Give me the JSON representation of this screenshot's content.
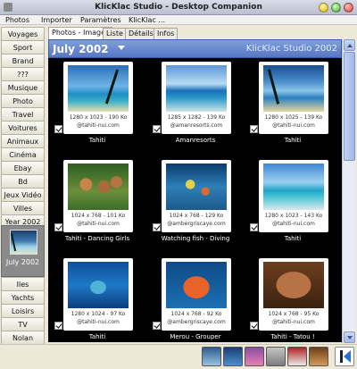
{
  "window": {
    "title": "KlicKlac Studio - Desktop Companion"
  },
  "menu": [
    "Photos",
    "Importer",
    "Paramètres",
    "KlicKlac ..."
  ],
  "sidebar": {
    "items": [
      "Voyages",
      "Sport",
      "Brand",
      "???",
      "Musique",
      "Photo",
      "Travel",
      "Voitures",
      "Animaux",
      "Cinéma",
      "Ebay",
      "Bd",
      "Jeux Vidéo",
      "Villes",
      "Year 2002"
    ],
    "selected": "July 2002",
    "items_after": [
      "Iles",
      "Yachts",
      "Loisirs",
      "TV",
      "Nolan"
    ]
  },
  "tabs": [
    "Photos - Images",
    "Liste",
    "Détails",
    "Infos"
  ],
  "header": {
    "period": "July 2002",
    "brand": "KlicKlac Studio 2002"
  },
  "photos": [
    {
      "meta1": "1280 x 1023 - 190 Ko",
      "meta2": "@tahiti-nui.com",
      "caption": "Tahiti",
      "art": "ph-beach"
    },
    {
      "meta1": "1285 x 1282 - 139 Ko",
      "meta2": "@amanresorts.com",
      "caption": "Amanresorts",
      "art": "ph-hut"
    },
    {
      "meta1": "1280 x 1025 - 139 Ko",
      "meta2": "@tahiti-nui.com",
      "caption": "Tahiti",
      "art": "ph-sunset"
    },
    {
      "meta1": "1024 x 768 - 101 Ko",
      "meta2": "@tahiti-nui.com",
      "caption": "Tahiti - Dancing Girls",
      "art": "ph-girls"
    },
    {
      "meta1": "1024 x 768 - 129 Ko",
      "meta2": "@ambergriscaye.com",
      "caption": "Watching fish - Diving",
      "art": "ph-dive"
    },
    {
      "meta1": "1280 x 1023 - 143 Ko",
      "meta2": "@tahiti-nui.com",
      "caption": "Tahiti",
      "art": "ph-resort"
    },
    {
      "meta1": "1280 x 1024 - 97 Ko",
      "meta2": "@tahiti-nui.com",
      "caption": "Tahiti",
      "art": "ph-sea"
    },
    {
      "meta1": "1024 x 768 - 92 Ko",
      "meta2": "@ambergriscaye.com",
      "caption": "Merou - Grouper",
      "art": "ph-grouper"
    },
    {
      "meta1": "1024 x 768 - 95 Ko",
      "meta2": "@tahiti-nui.com",
      "caption": "Tahiti - Tatou !",
      "art": "ph-tattoo"
    }
  ],
  "colors": {
    "accent": "#5f7fc8",
    "grid_bg": "#000000"
  }
}
